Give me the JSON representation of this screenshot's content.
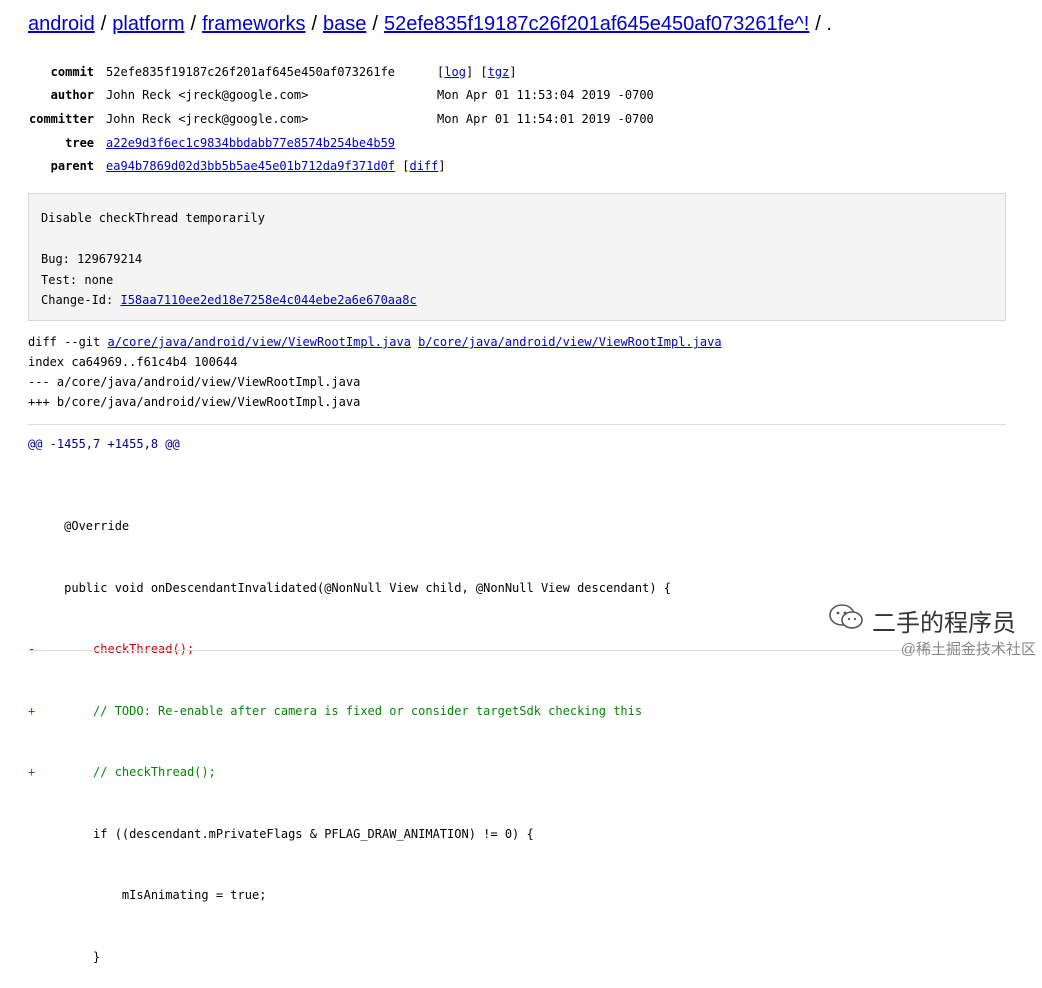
{
  "breadcrumb": {
    "items": [
      "android",
      "platform",
      "frameworks",
      "base",
      "52efe835f19187c26f201af645e450af073261fe^!"
    ],
    "separator": "/",
    "tail": "/ ."
  },
  "commit_meta": {
    "commit_label": "commit",
    "commit_hash": "52efe835f19187c26f201af645e450af073261fe",
    "log_link": "log",
    "tgz_link": "tgz",
    "author_label": "author",
    "author": "John Reck <jreck@google.com>",
    "author_date": "Mon Apr 01 11:53:04 2019 -0700",
    "committer_label": "committer",
    "committer": "John Reck <jreck@google.com>",
    "committer_date": "Mon Apr 01 11:54:01 2019 -0700",
    "tree_label": "tree",
    "tree_hash": "a22e9d3f6ec1c9834bbdabb77e8574b254be4b59",
    "parent_label": "parent",
    "parent_hash": "ea94b7869d02d3bb5b5ae45e01b712da9f371d0f",
    "diff_link": "diff"
  },
  "message": {
    "line1": "Disable checkThread temporarily",
    "line2": "Bug: 129679214",
    "line3": "Test: none",
    "change_id_label": "Change-Id: ",
    "change_id": "I58aa7110ee2ed18e7258e4c044ebe2a6e670aa8c"
  },
  "diff_header": {
    "prefix": "diff --git ",
    "file_a": "a/core/java/android/view/ViewRootImpl.java",
    "file_b": "b/core/java/android/view/ViewRootImpl.java",
    "index_line": "index ca64969..f61c4b4 100644",
    "minus_line": "--- a/core/java/android/view/ViewRootImpl.java",
    "plus_line": "+++ b/core/java/android/view/ViewRootImpl.java"
  },
  "hunk_header": "@@ -1455,7 +1455,8 @@",
  "code_lines": [
    {
      "type": "context",
      "text": "     @Override"
    },
    {
      "type": "context",
      "text": "     public void onDescendantInvalidated(@NonNull View child, @NonNull View descendant) {"
    },
    {
      "type": "del",
      "text": "-        checkThread();"
    },
    {
      "type": "add",
      "text": "+        // TODO: Re-enable after camera is fixed or consider targetSdk checking this"
    },
    {
      "type": "add",
      "text": "+        // checkThread();"
    },
    {
      "type": "context",
      "text": "         if ((descendant.mPrivateFlags & PFLAG_DRAW_ANIMATION) != 0) {"
    },
    {
      "type": "context",
      "text": "             mIsAnimating = true;"
    },
    {
      "type": "context",
      "text": "         }"
    }
  ],
  "watermark": {
    "main": "二手的程序员",
    "sub": "@稀土掘金技术社区"
  },
  "colors": {
    "link": "#0000cc",
    "deletion": "#d00000",
    "addition": "#008a00",
    "hunk": "#00008b",
    "message_bg": "#f4f4f4"
  }
}
